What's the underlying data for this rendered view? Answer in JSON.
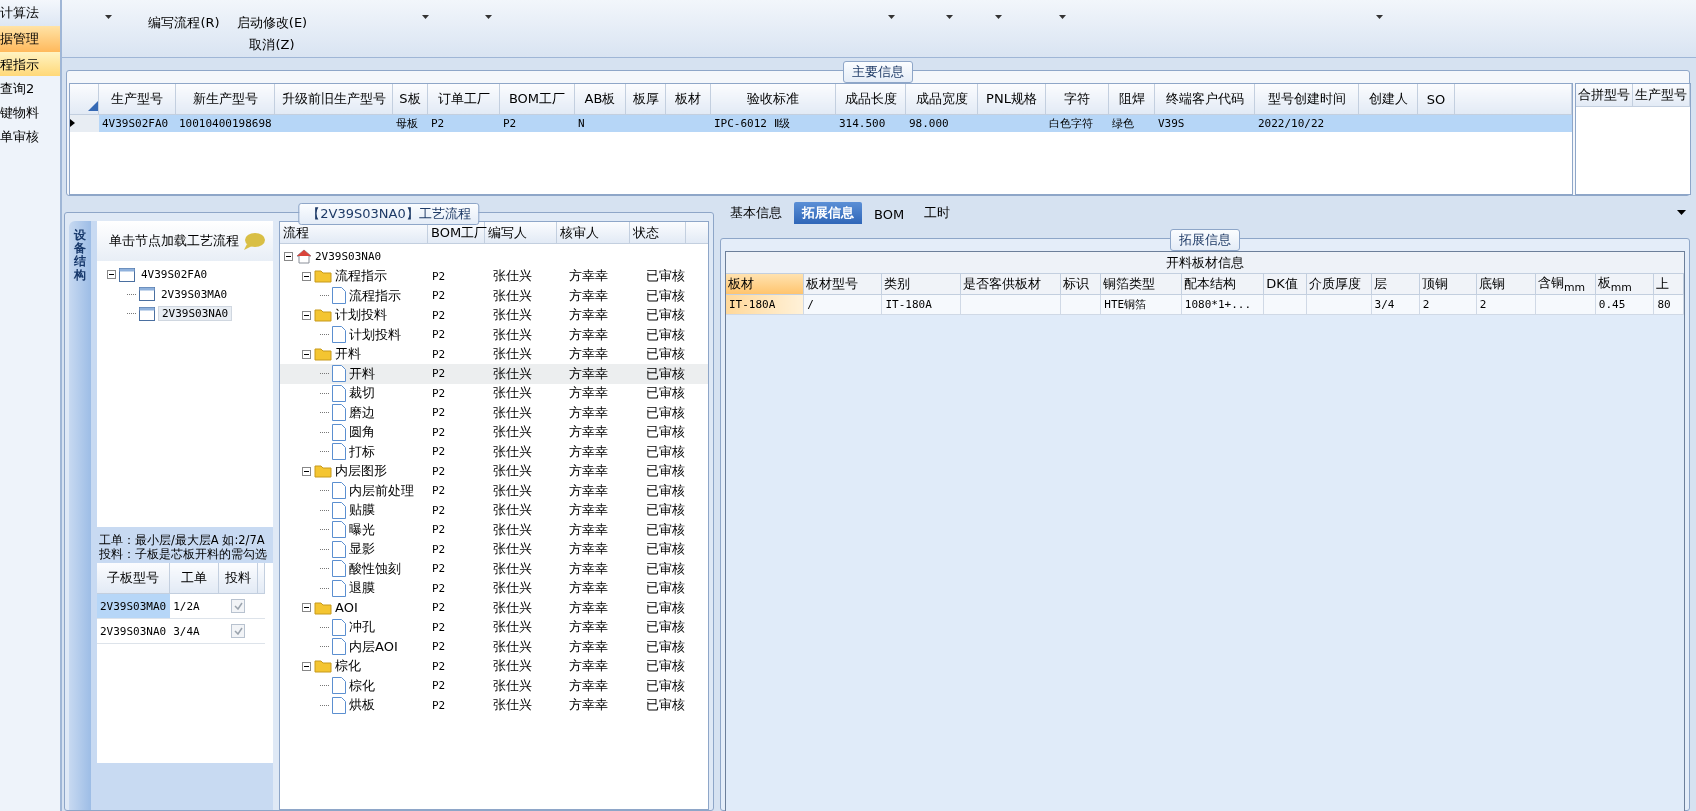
{
  "toolbar": {
    "buttons": [
      {
        "label": "编写流程(R)"
      },
      {
        "label": "启动修改(E)"
      },
      {
        "label": "取消(Z)"
      }
    ]
  },
  "sidebar": {
    "items": [
      {
        "kind": "header",
        "label": "计算法",
        "selected": false
      },
      {
        "kind": "header",
        "label": "据管理",
        "selected": true
      },
      {
        "kind": "flash",
        "label": "程指示",
        "selected": true
      },
      {
        "kind": "folder",
        "label": "查询2",
        "selected": false
      },
      {
        "kind": "folder",
        "label": "键物料",
        "selected": false
      },
      {
        "kind": "user",
        "label": "单审核",
        "selected": false
      }
    ]
  },
  "main_info": {
    "title": "主要信息",
    "table": {
      "columns": [
        "生产型号",
        "新生产型号",
        "升级前旧生产型号",
        "S板",
        "订单工厂",
        "BOM工厂",
        "AB板",
        "板厚",
        "板材",
        "验收标准",
        "成品长度",
        "成品宽度",
        "PNL规格",
        "字符",
        "阻焊",
        "终端客户代码",
        "型号创建时间",
        "创建人",
        "SO"
      ],
      "rows": [
        {
          "selected": true,
          "cells": [
            "4V39S02FA0",
            "10010400198698",
            null,
            "母板",
            "P2",
            "P2",
            "N",
            null,
            null,
            "IPC-6012 Ⅱ级",
            "314.500",
            "98.000",
            null,
            "白色字符",
            "绿色",
            "V39S",
            "2022/10/22",
            null,
            null
          ]
        }
      ]
    },
    "merge_table": {
      "columns": [
        "合拼型号",
        "生产型号"
      ]
    }
  },
  "process": {
    "title": "【2V39S03NA0】工艺流程",
    "side_tab": "设备结构",
    "structure_header": "单击节点加载工艺流程",
    "structure_tree": [
      {
        "label": "4V39S02FA0",
        "selected": false,
        "children": [
          {
            "label": "2V39S03MA0",
            "selected": false
          },
          {
            "label": "2V39S03NA0",
            "selected": true
          }
        ]
      }
    ],
    "notes": [
      "工单：最小层/最大层A 如:2/7A",
      "投料：子板是芯板开料的需勾选"
    ],
    "sub_boards": {
      "columns": [
        "子板型号",
        "工单",
        "投料"
      ],
      "rows": [
        {
          "selected": true,
          "model": "2V39S03MA0",
          "order": "1/2A",
          "checked": true
        },
        {
          "selected": false,
          "model": "2V39S03NA0",
          "order": "3/4A",
          "checked": true
        }
      ]
    },
    "flow": {
      "columns": [
        "流程",
        "BOM工厂",
        "编写人",
        "核审人",
        "状态"
      ],
      "tree": [
        {
          "label": "2V39S03NA0",
          "selected": false,
          "children": [
            {
              "label": "流程指示",
              "bom": "P2",
              "writer": "张仕兴",
              "reviewer": "方幸幸",
              "status": "已审核",
              "selected": false,
              "children": [
                {
                  "label": "流程指示",
                  "bom": "P2",
                  "writer": "张仕兴",
                  "reviewer": "方幸幸",
                  "status": "已审核",
                  "selected": false
                }
              ]
            },
            {
              "label": "计划投料",
              "bom": "P2",
              "writer": "张仕兴",
              "reviewer": "方幸幸",
              "status": "已审核",
              "selected": false,
              "children": [
                {
                  "label": "计划投料",
                  "bom": "P2",
                  "writer": "张仕兴",
                  "reviewer": "方幸幸",
                  "status": "已审核",
                  "selected": false
                }
              ]
            },
            {
              "label": "开料",
              "bom": "P2",
              "writer": "张仕兴",
              "reviewer": "方幸幸",
              "status": "已审核",
              "selected": false,
              "children": [
                {
                  "label": "开料",
                  "bom": "P2",
                  "writer": "张仕兴",
                  "reviewer": "方幸幸",
                  "status": "已审核",
                  "selected": true
                },
                {
                  "label": "裁切",
                  "bom": "P2",
                  "writer": "张仕兴",
                  "reviewer": "方幸幸",
                  "status": "已审核",
                  "selected": false
                },
                {
                  "label": "磨边",
                  "bom": "P2",
                  "writer": "张仕兴",
                  "reviewer": "方幸幸",
                  "status": "已审核",
                  "selected": false
                },
                {
                  "label": "圆角",
                  "bom": "P2",
                  "writer": "张仕兴",
                  "reviewer": "方幸幸",
                  "status": "已审核",
                  "selected": false
                },
                {
                  "label": "打标",
                  "bom": "P2",
                  "writer": "张仕兴",
                  "reviewer": "方幸幸",
                  "status": "已审核",
                  "selected": false
                }
              ]
            },
            {
              "label": "内层图形",
              "bom": "P2",
              "writer": "张仕兴",
              "reviewer": "方幸幸",
              "status": "已审核",
              "selected": false,
              "children": [
                {
                  "label": "内层前处理",
                  "bom": "P2",
                  "writer": "张仕兴",
                  "reviewer": "方幸幸",
                  "status": "已审核",
                  "selected": false
                },
                {
                  "label": "贴膜",
                  "bom": "P2",
                  "writer": "张仕兴",
                  "reviewer": "方幸幸",
                  "status": "已审核",
                  "selected": false
                },
                {
                  "label": "曝光",
                  "bom": "P2",
                  "writer": "张仕兴",
                  "reviewer": "方幸幸",
                  "status": "已审核",
                  "selected": false
                },
                {
                  "label": "显影",
                  "bom": "P2",
                  "writer": "张仕兴",
                  "reviewer": "方幸幸",
                  "status": "已审核",
                  "selected": false
                },
                {
                  "label": "酸性蚀刻",
                  "bom": "P2",
                  "writer": "张仕兴",
                  "reviewer": "方幸幸",
                  "status": "已审核",
                  "selected": false
                },
                {
                  "label": "退膜",
                  "bom": "P2",
                  "writer": "张仕兴",
                  "reviewer": "方幸幸",
                  "status": "已审核",
                  "selected": false
                }
              ]
            },
            {
              "label": "AOI",
              "bom": "P2",
              "writer": "张仕兴",
              "reviewer": "方幸幸",
              "status": "已审核",
              "selected": false,
              "children": [
                {
                  "label": "冲孔",
                  "bom": "P2",
                  "writer": "张仕兴",
                  "reviewer": "方幸幸",
                  "status": "已审核",
                  "selected": false
                },
                {
                  "label": "内层AOI",
                  "bom": "P2",
                  "writer": "张仕兴",
                  "reviewer": "方幸幸",
                  "status": "已审核",
                  "selected": false
                }
              ]
            },
            {
              "label": "棕化",
              "bom": "P2",
              "writer": "张仕兴",
              "reviewer": "方幸幸",
              "status": "已审核",
              "selected": false,
              "children": [
                {
                  "label": "棕化",
                  "bom": "P2",
                  "writer": "张仕兴",
                  "reviewer": "方幸幸",
                  "status": "已审核",
                  "selected": false
                },
                {
                  "label": "烘板",
                  "bom": "P2",
                  "writer": "张仕兴",
                  "reviewer": "方幸幸",
                  "status": "已审核",
                  "selected": false
                }
              ]
            }
          ]
        }
      ]
    }
  },
  "detail": {
    "tabs": [
      {
        "label": "基本信息",
        "selected": false
      },
      {
        "label": "拓展信息",
        "selected": true
      },
      {
        "label": "BOM",
        "selected": false
      },
      {
        "label": "工时",
        "selected": false
      }
    ],
    "group_title": "拓展信息",
    "table": {
      "title": "开料板材信息",
      "columns": [
        {
          "label": "板材",
          "selected": true
        },
        {
          "label": "板材型号",
          "selected": false
        },
        {
          "label": "类别",
          "selected": false
        },
        {
          "label": "是否客供板材",
          "selected": false
        },
        {
          "label": "标识",
          "selected": false
        },
        {
          "label": "铜箔类型",
          "selected": false
        },
        {
          "label": "配本结构",
          "selected": false
        },
        {
          "label": "DK值",
          "selected": false
        },
        {
          "label": "介质厚度",
          "selected": false
        },
        {
          "label": "层",
          "selected": false
        },
        {
          "label": "顶铜",
          "selected": false
        },
        {
          "label": "底铜",
          "selected": false
        },
        {
          "label": "含铜$_{mm}$",
          "selected": false
        },
        {
          "label": "板$_{mm}$",
          "selected": false
        },
        {
          "label": "上",
          "selected": false
        }
      ],
      "rows": [
        {
          "cells": [
            "IT-180A",
            "/",
            "IT-180A",
            null,
            null,
            "HTE铜箔",
            "1080*1+...",
            null,
            null,
            "3/4",
            "2",
            "2",
            null,
            "0.45",
            "80"
          ]
        }
      ]
    }
  }
}
